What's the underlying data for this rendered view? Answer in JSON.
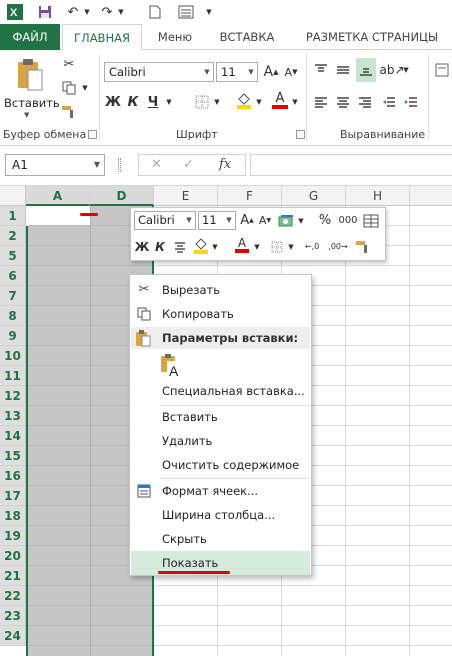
{
  "ribbon_tabs": {
    "file": "ФАЙЛ",
    "home": "ГЛАВНАЯ",
    "menu": "Меню",
    "insert": "ВСТАВКА",
    "page_layout": "РАЗМЕТКА СТРАНИЦЫ"
  },
  "clipboard": {
    "paste_label": "Вставить",
    "group_label": "Буфер обмена"
  },
  "font": {
    "font_name": "Calibri",
    "font_size": "11",
    "bold": "Ж",
    "italic": "К",
    "underline": "Ч",
    "group_label": "Шрифт"
  },
  "alignment": {
    "group_label": "Выравнивание"
  },
  "formula_bar": {
    "name_box": "A1",
    "fx": "fx",
    "cancel": "✕",
    "enter": "✓"
  },
  "grid": {
    "columns": [
      "A",
      "D",
      "E",
      "F",
      "G",
      "H"
    ],
    "rows": [
      "1",
      "2",
      "5",
      "6",
      "7",
      "8",
      "9",
      "10",
      "11",
      "12",
      "13",
      "14",
      "15",
      "16",
      "17",
      "18",
      "19",
      "20",
      "21",
      "22",
      "23",
      "24"
    ]
  },
  "mini_toolbar": {
    "font_name": "Calibri",
    "font_size": "11",
    "percent": "%",
    "thousands": "000",
    "bold": "Ж",
    "italic": "К"
  },
  "context_menu": {
    "cut": "Вырезать",
    "copy": "Копировать",
    "paste_options_header": "Параметры вставки:",
    "paste_special": "Специальная вставка...",
    "insert": "Вставить",
    "delete": "Удалить",
    "clear_contents": "Очистить содержимое",
    "format_cells": "Формат ячеек...",
    "column_width": "Ширина столбца...",
    "hide": "Скрыть",
    "unhide": "Показать"
  },
  "colors": {
    "accent": "#217346",
    "highlight": "#d5ebde",
    "annotation": "#e00000",
    "font_color": "#e00000",
    "fill_color": "#ffd700"
  }
}
